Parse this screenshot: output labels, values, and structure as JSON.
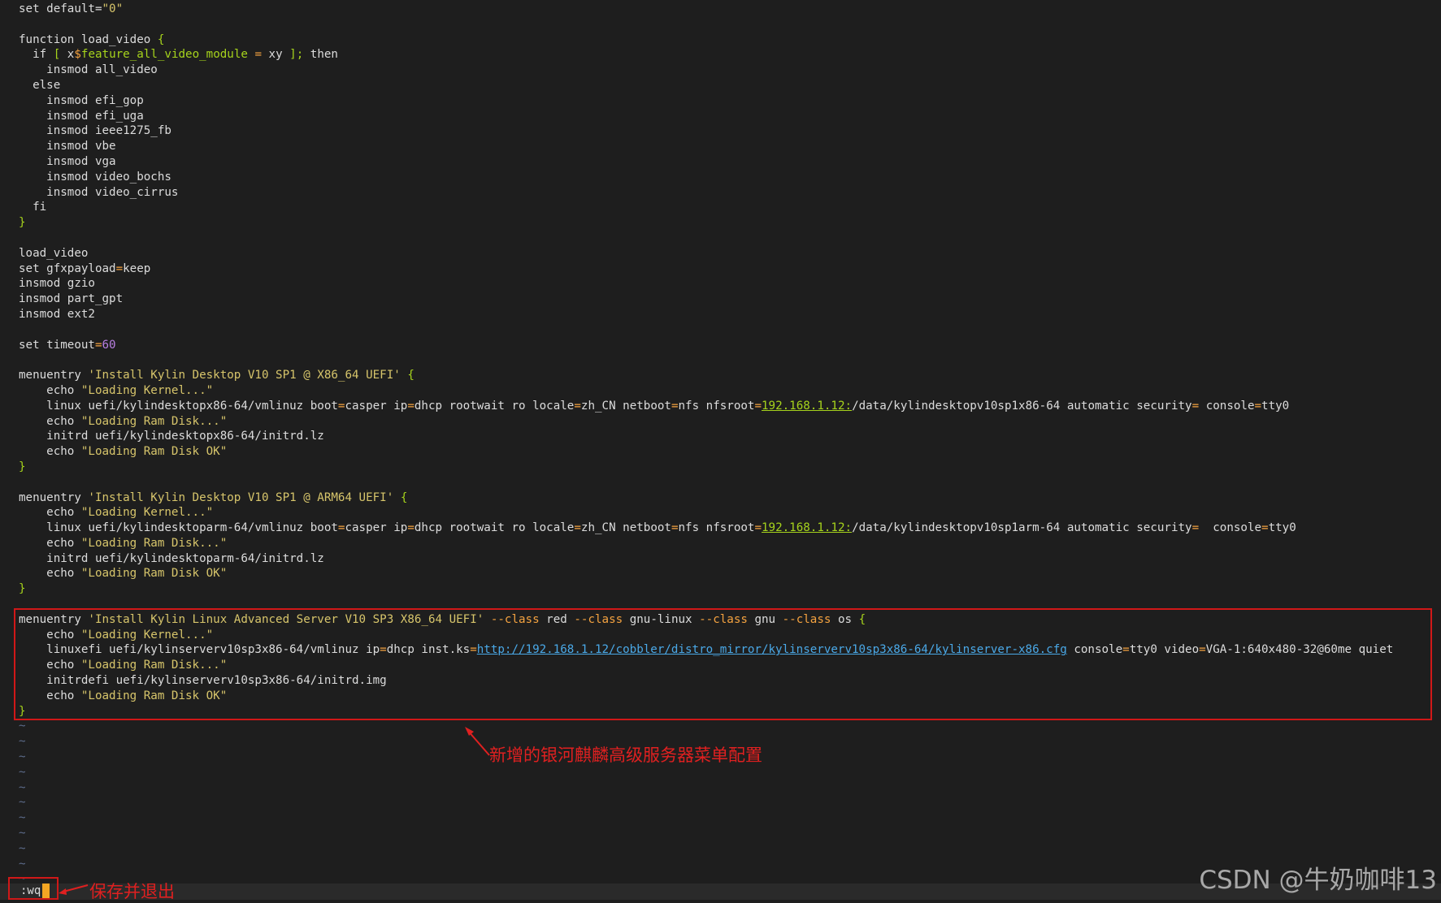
{
  "lines": [
    [
      [
        "set default=",
        ""
      ],
      [
        "\"0\"",
        "str"
      ]
    ],
    [],
    [
      [
        "function load_video ",
        ""
      ],
      [
        "{",
        "br"
      ]
    ],
    [
      [
        "  if ",
        ""
      ],
      [
        "[",
        "br"
      ],
      [
        " x",
        ""
      ],
      [
        "$",
        "op"
      ],
      [
        "feature_all_video_module ",
        "var"
      ],
      [
        "=",
        "op"
      ],
      [
        " xy ",
        ""
      ],
      [
        "];",
        "br"
      ],
      [
        " then",
        ""
      ]
    ],
    [
      [
        "    insmod all_video",
        ""
      ]
    ],
    [
      [
        "  else",
        ""
      ]
    ],
    [
      [
        "    insmod efi_gop",
        ""
      ]
    ],
    [
      [
        "    insmod efi_uga",
        ""
      ]
    ],
    [
      [
        "    insmod ieee1275_fb",
        ""
      ]
    ],
    [
      [
        "    insmod vbe",
        ""
      ]
    ],
    [
      [
        "    insmod vga",
        ""
      ]
    ],
    [
      [
        "    insmod video_bochs",
        ""
      ]
    ],
    [
      [
        "    insmod video_cirrus",
        ""
      ]
    ],
    [
      [
        "  fi",
        ""
      ]
    ],
    [
      [
        "}",
        "br"
      ]
    ],
    [],
    [
      [
        "load_video",
        ""
      ]
    ],
    [
      [
        "set gfxpayload",
        ""
      ],
      [
        "=",
        "op"
      ],
      [
        "keep",
        ""
      ]
    ],
    [
      [
        "insmod gzio",
        ""
      ]
    ],
    [
      [
        "insmod part_gpt",
        ""
      ]
    ],
    [
      [
        "insmod ext2",
        ""
      ]
    ],
    [],
    [
      [
        "set timeout",
        ""
      ],
      [
        "=",
        "op"
      ],
      [
        "60",
        "num"
      ]
    ],
    [],
    [
      [
        "menuentry ",
        ""
      ],
      [
        "'Install Kylin Desktop V10 SP1 @ X86_64 UEFI'",
        "str"
      ],
      [
        " ",
        ""
      ],
      [
        "{",
        "br"
      ]
    ],
    [
      [
        "    echo ",
        ""
      ],
      [
        "\"Loading Kernel...\"",
        "str"
      ]
    ],
    [
      [
        "    linux uefi/kylindesktopx86-64/vmlinuz boot",
        ""
      ],
      [
        "=",
        "op"
      ],
      [
        "casper ip",
        ""
      ],
      [
        "=",
        "op"
      ],
      [
        "dhcp rootwait ro locale",
        ""
      ],
      [
        "=",
        "op"
      ],
      [
        "zh_CN netboot",
        ""
      ],
      [
        "=",
        "op"
      ],
      [
        "nfs nfsroot",
        ""
      ],
      [
        "=",
        "op"
      ],
      [
        "192.168.1.12:",
        "ipu"
      ],
      [
        "/data/kylindesktopv10sp1x86-64 automatic security",
        ""
      ],
      [
        "=",
        "op"
      ],
      [
        " console",
        ""
      ],
      [
        "=",
        "op"
      ],
      [
        "tty0",
        ""
      ]
    ],
    [
      [
        "    echo ",
        ""
      ],
      [
        "\"Loading Ram Disk...\"",
        "str"
      ]
    ],
    [
      [
        "    initrd uefi/kylindesktopx86-64/initrd.lz",
        ""
      ]
    ],
    [
      [
        "    echo ",
        ""
      ],
      [
        "\"Loading Ram Disk OK\"",
        "str"
      ]
    ],
    [
      [
        "}",
        "br"
      ]
    ],
    [],
    [
      [
        "menuentry ",
        ""
      ],
      [
        "'Install Kylin Desktop V10 SP1 @ ARM64 UEFI'",
        "str"
      ],
      [
        " ",
        ""
      ],
      [
        "{",
        "br"
      ]
    ],
    [
      [
        "    echo ",
        ""
      ],
      [
        "\"Loading Kernel...\"",
        "str"
      ]
    ],
    [
      [
        "    linux uefi/kylindesktoparm-64/vmlinuz boot",
        ""
      ],
      [
        "=",
        "op"
      ],
      [
        "casper ip",
        ""
      ],
      [
        "=",
        "op"
      ],
      [
        "dhcp rootwait ro locale",
        ""
      ],
      [
        "=",
        "op"
      ],
      [
        "zh_CN netboot",
        ""
      ],
      [
        "=",
        "op"
      ],
      [
        "nfs nfsroot",
        ""
      ],
      [
        "=",
        "op"
      ],
      [
        "192.168.1.12:",
        "ipu"
      ],
      [
        "/data/kylindesktopv10sp1arm-64 automatic security",
        ""
      ],
      [
        "=",
        "op"
      ],
      [
        "  console",
        ""
      ],
      [
        "=",
        "op"
      ],
      [
        "tty0",
        ""
      ]
    ],
    [
      [
        "    echo ",
        ""
      ],
      [
        "\"Loading Ram Disk...\"",
        "str"
      ]
    ],
    [
      [
        "    initrd uefi/kylindesktoparm-64/initrd.lz",
        ""
      ]
    ],
    [
      [
        "    echo ",
        ""
      ],
      [
        "\"Loading Ram Disk OK\"",
        "str"
      ]
    ],
    [
      [
        "}",
        "br"
      ]
    ],
    [],
    [
      [
        "menuentry ",
        ""
      ],
      [
        "'Install Kylin Linux Advanced Server V10 SP3 X86_64 UEFI'",
        "str"
      ],
      [
        " ",
        ""
      ],
      [
        "--class",
        "op"
      ],
      [
        " red ",
        ""
      ],
      [
        "--class",
        "op"
      ],
      [
        " gnu-linux ",
        ""
      ],
      [
        "--class",
        "op"
      ],
      [
        " gnu ",
        ""
      ],
      [
        "--class",
        "op"
      ],
      [
        " os ",
        ""
      ],
      [
        "{",
        "br"
      ]
    ],
    [
      [
        "    echo ",
        ""
      ],
      [
        "\"Loading Kernel...\"",
        "str"
      ]
    ],
    [
      [
        "    linuxefi uefi/kylinserverv10sp3x86-64/vmlinuz ip",
        ""
      ],
      [
        "=",
        "op"
      ],
      [
        "dhcp inst.ks",
        ""
      ],
      [
        "=",
        "op"
      ],
      [
        "http://192.168.1.12/cobbler/distro_mirror/kylinserverv10sp3x86-64/kylinserver-x86.cfg",
        "link"
      ],
      [
        " console",
        ""
      ],
      [
        "=",
        "op"
      ],
      [
        "tty0 video",
        ""
      ],
      [
        "=",
        "op"
      ],
      [
        "VGA-1:640x480-32@60me quiet",
        ""
      ]
    ],
    [
      [
        "    echo ",
        ""
      ],
      [
        "\"Loading Ram Disk...\"",
        "str"
      ]
    ],
    [
      [
        "    initrdefi uefi/kylinserverv10sp3x86-64/initrd.img",
        ""
      ]
    ],
    [
      [
        "    echo ",
        ""
      ],
      [
        "\"Loading Ram Disk OK\"",
        "str"
      ]
    ],
    [
      [
        "}",
        "br"
      ]
    ],
    [
      [
        "~",
        "tilde"
      ]
    ],
    [
      [
        "~",
        "tilde"
      ]
    ],
    [
      [
        "~",
        "tilde"
      ]
    ],
    [
      [
        "~",
        "tilde"
      ]
    ],
    [
      [
        "~",
        "tilde"
      ]
    ],
    [
      [
        "~",
        "tilde"
      ]
    ],
    [
      [
        "~",
        "tilde"
      ]
    ],
    [
      [
        "~",
        "tilde"
      ]
    ],
    [
      [
        "~",
        "tilde"
      ]
    ],
    [
      [
        "~",
        "tilde"
      ]
    ],
    [
      [
        "~",
        "tilde"
      ]
    ]
  ],
  "cmdline": ":wq",
  "annotations": {
    "new_menu": "新增的银河麒麟高级服务器菜单配置",
    "save_quit": "保存并退出"
  },
  "watermark": "CSDN @牛奶咖啡13",
  "colors": {
    "background": "#1e1e1e",
    "text": "#dcdcdc",
    "string": "#d7c56b",
    "number": "#b87fe0",
    "brace": "#a6d31c",
    "operator": "#f5a340",
    "link": "#4aa9e8",
    "annotation": "#d01818",
    "cursor": "#f5a623"
  }
}
